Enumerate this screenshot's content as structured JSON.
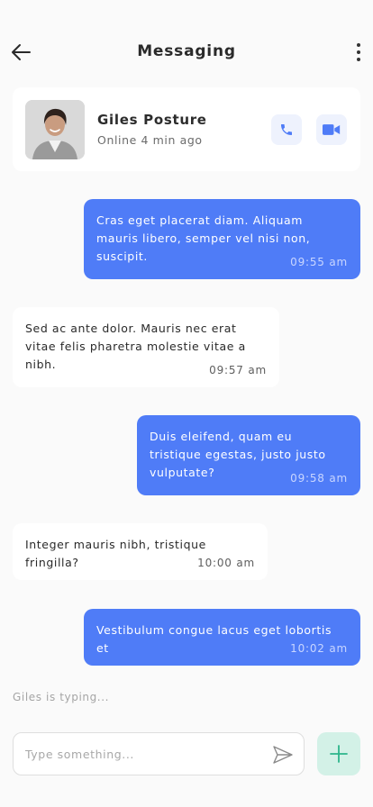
{
  "header": {
    "title": "Messaging",
    "back_icon": "arrow-left-icon",
    "more_icon": "more-vertical-icon"
  },
  "contact": {
    "name": "Giles Posture",
    "status": "Online 4 min ago",
    "call_icon": "phone-icon",
    "video_icon": "video-camera-icon"
  },
  "messages": [
    {
      "direction": "outgoing",
      "text": "Cras eget placerat diam. Aliquam mauris libero, semper vel nisi non, suscipit.",
      "time": "09:55 am"
    },
    {
      "direction": "incoming",
      "text": "Sed ac ante dolor. Mauris nec erat vitae felis pharetra molestie vitae a nibh.",
      "time": "09:57 am"
    },
    {
      "direction": "outgoing",
      "text": "Duis eleifend, quam eu tristique egestas, justo justo vulputate?",
      "time": "09:58 am"
    },
    {
      "direction": "incoming",
      "text": "Integer mauris nibh, tristique fringilla?",
      "time": "10:00 am"
    },
    {
      "direction": "outgoing",
      "text": "Vestibulum congue lacus eget lobortis et",
      "time": "10:02 am"
    }
  ],
  "typing_indicator": "Giles is typing...",
  "composer": {
    "placeholder": "Type something...",
    "send_icon": "send-icon",
    "add_icon": "plus-icon"
  },
  "colors": {
    "accent": "#4f7cf7",
    "add_button_bg": "#d3f1e7",
    "add_button_icon": "#2bb58a"
  }
}
